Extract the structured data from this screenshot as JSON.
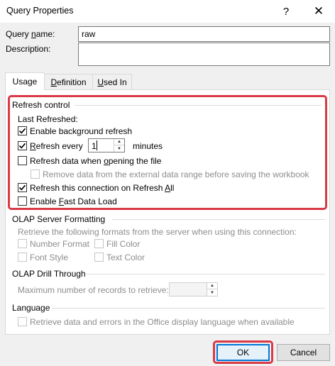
{
  "window": {
    "title": "Query Properties",
    "help_glyph": "?",
    "close_glyph": "✕"
  },
  "fields": {
    "query_name_label_pre": "Query ",
    "query_name_label_u": "n",
    "query_name_label_post": "ame:",
    "query_name_value": "raw",
    "description_label": "Description:",
    "description_value": ""
  },
  "tabs": [
    {
      "label": "Usage",
      "active": true
    },
    {
      "label": "Definition",
      "u": "D",
      "rest": "efinition",
      "active": false
    },
    {
      "label": "Used In",
      "u": "U",
      "rest": "sed In",
      "active": false
    }
  ],
  "refresh_control": {
    "title": "Refresh control",
    "last_refreshed": "Last Refreshed:",
    "enable_background_pre": "Enable back",
    "enable_background_u": "g",
    "enable_background_post": "round refresh",
    "enable_background_checked": true,
    "refresh_every_u": "R",
    "refresh_every_rest": "efresh every",
    "refresh_every_checked": true,
    "refresh_every_value": "1",
    "minutes": "minutes",
    "refresh_on_open_pre": "Refresh data when ",
    "refresh_on_open_u": "o",
    "refresh_on_open_post": "pening the file",
    "refresh_on_open_checked": false,
    "remove_data": "Remove data from the external data range before saving the workbook",
    "remove_data_checked": false,
    "refresh_all_pre": "Refresh this connection on Refresh ",
    "refresh_all_u": "A",
    "refresh_all_post": "ll",
    "refresh_all_checked": true,
    "fast_load_pre": "Enable ",
    "fast_load_u": "F",
    "fast_load_post": "ast Data Load",
    "fast_load_checked": false
  },
  "olap_formatting": {
    "title": "OLAP Server Formatting",
    "description": "Retrieve the following formats from the server when using this connection:",
    "number_format": "Number Format",
    "fill_color": "Fill Color",
    "font_style": "Font Style",
    "text_color": "Text Color"
  },
  "olap_drill": {
    "title": "OLAP Drill Through",
    "max_records": "Maximum number of records to retrieve:",
    "max_records_value": ""
  },
  "language": {
    "title": "Language",
    "retrieve": "Retrieve data and errors in the Office display language when available"
  },
  "buttons": {
    "ok": "OK",
    "cancel": "Cancel"
  },
  "colors": {
    "highlight": "#d93a45",
    "focus": "#0078d7"
  }
}
